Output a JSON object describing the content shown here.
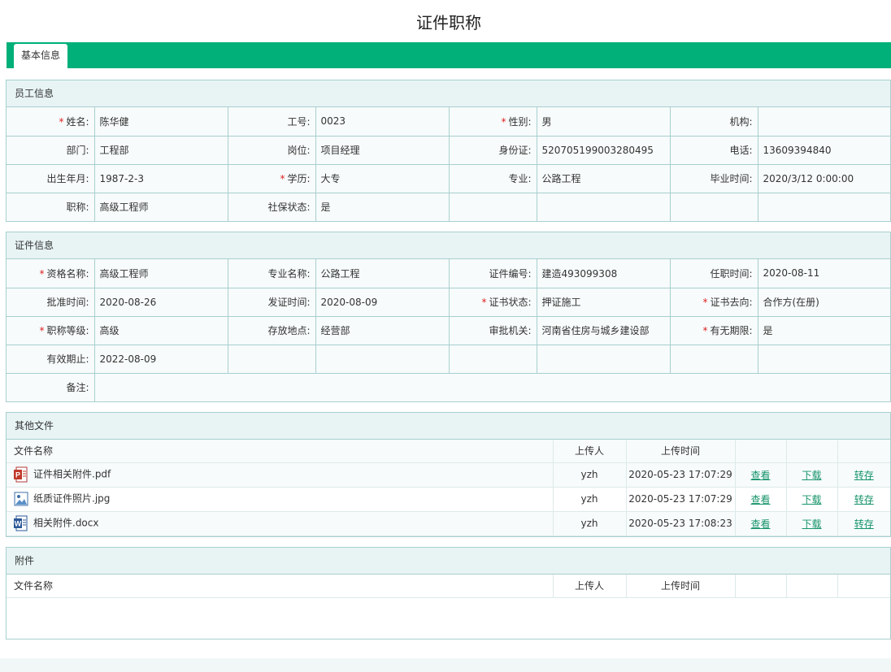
{
  "page_title": "证件职称",
  "tabs": [
    "基本信息"
  ],
  "colors": {
    "accent": "#00b078",
    "link": "#16946a",
    "required": "#e02020",
    "border": "#a9cfcf"
  },
  "employee": {
    "section_title": "员工信息",
    "rows": [
      [
        {
          "label": "姓名:",
          "value": "陈华健",
          "required": true
        },
        {
          "label": "工号:",
          "value": "0023",
          "required": false
        },
        {
          "label": "性别:",
          "value": "男",
          "required": true
        },
        {
          "label": "机构:",
          "value": "",
          "required": false
        }
      ],
      [
        {
          "label": "部门:",
          "value": "工程部",
          "required": false
        },
        {
          "label": "岗位:",
          "value": "项目经理",
          "required": false
        },
        {
          "label": "身份证:",
          "value": "520705199003280495",
          "required": false
        },
        {
          "label": "电话:",
          "value": "13609394840",
          "required": false
        }
      ],
      [
        {
          "label": "出生年月:",
          "value": "1987-2-3",
          "required": false
        },
        {
          "label": "学历:",
          "value": "大专",
          "required": true
        },
        {
          "label": "专业:",
          "value": "公路工程",
          "required": false
        },
        {
          "label": "毕业时间:",
          "value": "2020/3/12 0:00:00",
          "required": false
        }
      ],
      [
        {
          "label": "职称:",
          "value": "高级工程师",
          "required": false
        },
        {
          "label": "社保状态:",
          "value": "是",
          "required": false
        },
        {
          "label": "",
          "value": "",
          "required": false
        },
        {
          "label": "",
          "value": "",
          "required": false
        }
      ]
    ]
  },
  "certificate": {
    "section_title": "证件信息",
    "rows": [
      [
        {
          "label": "资格名称:",
          "value": "高级工程师",
          "required": true
        },
        {
          "label": "专业名称:",
          "value": "公路工程",
          "required": false
        },
        {
          "label": "证件编号:",
          "value": "建造493099308",
          "required": false
        },
        {
          "label": "任职时间:",
          "value": "2020-08-11",
          "required": false
        }
      ],
      [
        {
          "label": "批准时间:",
          "value": "2020-08-26",
          "required": false
        },
        {
          "label": "发证时间:",
          "value": "2020-08-09",
          "required": false
        },
        {
          "label": "证书状态:",
          "value": "押证施工",
          "required": true
        },
        {
          "label": "证书去向:",
          "value": "合作方(在册)",
          "required": true
        }
      ],
      [
        {
          "label": "职称等级:",
          "value": "高级",
          "required": true
        },
        {
          "label": "存放地点:",
          "value": "经营部",
          "required": false
        },
        {
          "label": "审批机关:",
          "value": "河南省住房与城乡建设部",
          "required": false
        },
        {
          "label": "有无期限:",
          "value": "是",
          "required": true
        }
      ],
      [
        {
          "label": "有效期止:",
          "value": "2022-08-09",
          "required": false
        },
        {
          "label": "",
          "value": "",
          "required": false
        },
        {
          "label": "",
          "value": "",
          "required": false
        },
        {
          "label": "",
          "value": "",
          "required": false
        }
      ]
    ],
    "remark_label": "备注:",
    "remark_value": ""
  },
  "other_files": {
    "section_title": "其他文件",
    "columns": {
      "name": "文件名称",
      "uploader": "上传人",
      "time": "上传时间"
    },
    "files": [
      {
        "icon": "pdf-file-icon",
        "name": "证件相关附件.pdf",
        "uploader": "yzh",
        "time": "2020-05-23 17:07:29",
        "view": "查看",
        "download": "下载",
        "transfer": "转存"
      },
      {
        "icon": "image-file-icon",
        "name": "纸质证件照片.jpg",
        "uploader": "yzh",
        "time": "2020-05-23 17:07:29",
        "view": "查看",
        "download": "下载",
        "transfer": "转存"
      },
      {
        "icon": "word-file-icon",
        "name": "相关附件.docx",
        "uploader": "yzh",
        "time": "2020-05-23 17:08:23",
        "view": "查看",
        "download": "下载",
        "transfer": "转存"
      }
    ]
  },
  "attachments": {
    "section_title": "附件",
    "columns": {
      "name": "文件名称",
      "uploader": "上传人",
      "time": "上传时间"
    },
    "files": []
  }
}
